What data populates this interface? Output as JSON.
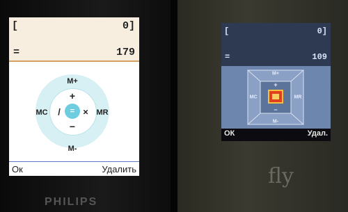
{
  "left_phone": {
    "brand": "PHILIPS",
    "display": {
      "bracket_open": "[",
      "bracket_value": "0]",
      "equals": "=",
      "result": "179"
    },
    "keys": {
      "top": "M+",
      "bottom": "M-",
      "left": "MC",
      "right": "MR",
      "up": "+",
      "down": "−",
      "center": "=",
      "divide": "/",
      "multiply": "×"
    },
    "softkeys": {
      "left": "Ок",
      "right": "Удалить"
    }
  },
  "right_phone": {
    "brand": "fly",
    "display": {
      "bracket_open": "[",
      "bracket_value": "0]",
      "equals": "=",
      "result": "109"
    },
    "keys": {
      "top": "M+",
      "bottom": "M-",
      "left": "MC",
      "right": "MR",
      "up": "+",
      "down": "−"
    },
    "softkeys": {
      "left": "ОК",
      "right": "Удал."
    }
  },
  "colors": {
    "left_accent": "#d4a060",
    "left_ring": "#cfeef3",
    "left_center": "#6fcde0",
    "right_panel": "#6d86ae",
    "right_center": "#e04020"
  }
}
